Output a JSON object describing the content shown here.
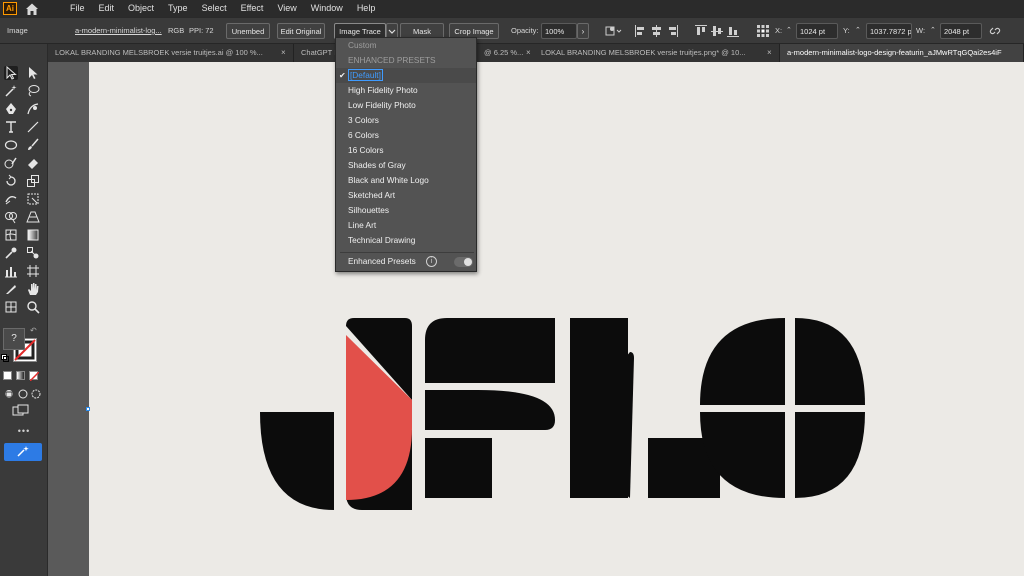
{
  "app": {
    "logo_text": "Ai"
  },
  "menu": [
    "File",
    "Edit",
    "Object",
    "Type",
    "Select",
    "Effect",
    "View",
    "Window",
    "Help"
  ],
  "controlbar": {
    "selection_type": "Image",
    "file_name": "a-modern-minimalist-log...",
    "color_mode": "RGB",
    "ppi": "PPI: 72",
    "unembed": "Unembed",
    "edit_original": "Edit Original",
    "image_trace": "Image Trace",
    "mask": "Mask",
    "crop_image": "Crop Image",
    "opacity_label": "Opacity:",
    "opacity_value": "100%",
    "x_label": "X:",
    "x_value": "1024 pt",
    "y_label": "Y:",
    "y_value": "1037.7872 p",
    "w_label": "W:",
    "w_value": "2048 pt"
  },
  "tabs": [
    {
      "label": "LOKAL BRANDING MELSBROEK versie truitjes.ai @ 100 %...",
      "close": "×"
    },
    {
      "label": "ChatGPT I",
      "close": "×"
    },
    {
      "label": "@ 6.25 %...",
      "close": "×"
    },
    {
      "label": "LOKAL BRANDING MELSBROEK versie truitjes.png* @ 10...",
      "close": "×"
    },
    {
      "label": "a-modern-minimalist-logo-design-featurin_aJMwRTqGQai2es4iF",
      "close": ""
    }
  ],
  "trace_menu": {
    "items": [
      {
        "label": "Custom",
        "state": "disabled"
      },
      {
        "label": "ENHANCED PRESETS",
        "state": "disabled"
      },
      {
        "label": "[Default]",
        "state": "checked"
      },
      {
        "label": "High Fidelity Photo",
        "state": "normal"
      },
      {
        "label": "Low Fidelity Photo",
        "state": "normal"
      },
      {
        "label": "3 Colors",
        "state": "normal"
      },
      {
        "label": "6 Colors",
        "state": "normal"
      },
      {
        "label": "16 Colors",
        "state": "normal"
      },
      {
        "label": "Shades of Gray",
        "state": "normal"
      },
      {
        "label": "Black and White Logo",
        "state": "normal"
      },
      {
        "label": "Sketched Art",
        "state": "normal"
      },
      {
        "label": "Silhouettes",
        "state": "normal"
      },
      {
        "label": "Line Art",
        "state": "normal"
      },
      {
        "label": "Technical Drawing",
        "state": "normal"
      }
    ],
    "checkmark": "✔",
    "enhanced_label": "Enhanced Presets",
    "enhanced_info": "i",
    "enhanced_enabled": true
  },
  "toolbar": {
    "unknown_color_label": "?",
    "more_tools": "•••"
  },
  "colors": {
    "accent_red": "#e2504a",
    "logo_black": "#0c0c0c",
    "artboard": "#eceae6",
    "highlight_blue": "#3f9bff"
  }
}
